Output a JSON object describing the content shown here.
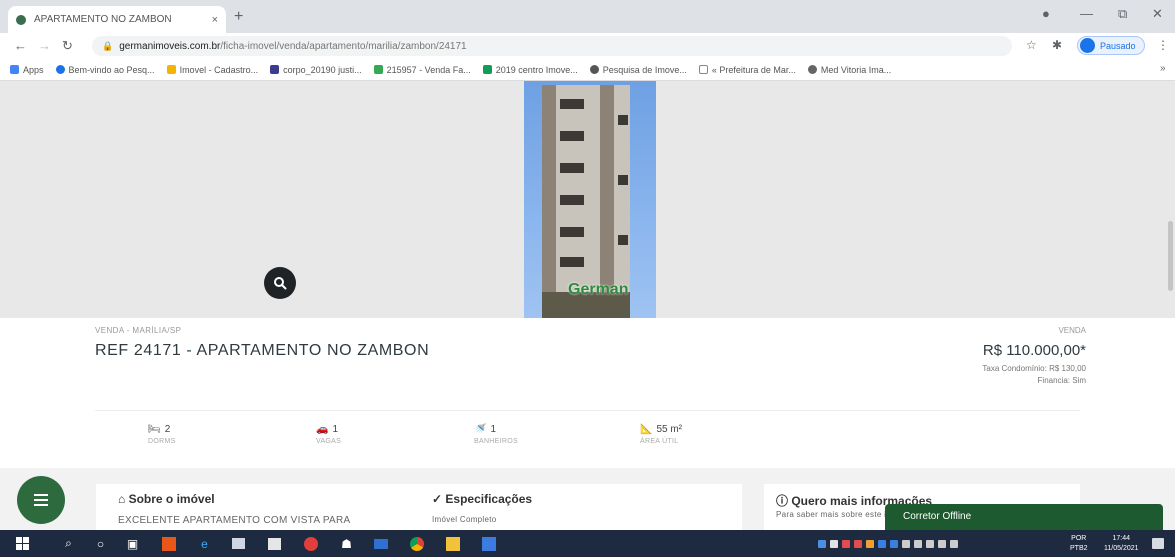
{
  "browser": {
    "tab_title": "APARTAMENTO NO ZAMBON",
    "tab_close": "×",
    "new_tab": "+",
    "url_domain": "germanimoveis.com.br",
    "url_path": "/ficha-imovel/venda/apartamento/marilia/zambon/24171",
    "profile_label": "Pausado",
    "bookmarks": [
      "Apps",
      "Bem-vindo ao Pesq...",
      "Imovel - Cadastro...",
      "corpo_20190 justi...",
      "215957 - Venda Fa...",
      "2019 centro Imove...",
      "Pesquisa de Imove...",
      "« Prefeitura de Mar...",
      "Med Vitoria Ima..."
    ]
  },
  "listing": {
    "breadcrumb": "VENDA - MARÍLIA/SP",
    "title": "REF 24171 - APARTAMENTO NO ZAMBON",
    "price_label": "VENDA",
    "price": "R$ 110.000,00*",
    "condo_fee": "Taxa Condomínio: R$ 130,00",
    "financing": "Financia: Sim",
    "photo_logo": "German",
    "features": [
      {
        "value": "2",
        "label": "DORMS"
      },
      {
        "value": "1",
        "label": "VAGAS"
      },
      {
        "value": "1",
        "label": "BANHEIROS"
      },
      {
        "value": "55 m²",
        "label": "ÁREA ÚTIL"
      }
    ]
  },
  "sections": {
    "about_title": "Sobre o imóvel",
    "about_text": "EXCELENTE APARTAMENTO COM VISTA PARA",
    "specs_title": "Especificações",
    "specs_text": "Imóvel Completo",
    "contact_title": "Quero mais informações",
    "contact_text": "Para saber mais sobre este imóvel"
  },
  "chat": {
    "label": "Corretor Offline"
  },
  "taskbar": {
    "lang_line1": "POR",
    "lang_line2": "PTB2",
    "time": "17:44",
    "date": "11/05/2021"
  },
  "colors": {
    "brand_green": "#2d6b3f",
    "chat_green": "#1e5a2f",
    "taskbar": "#1e2a3f"
  }
}
